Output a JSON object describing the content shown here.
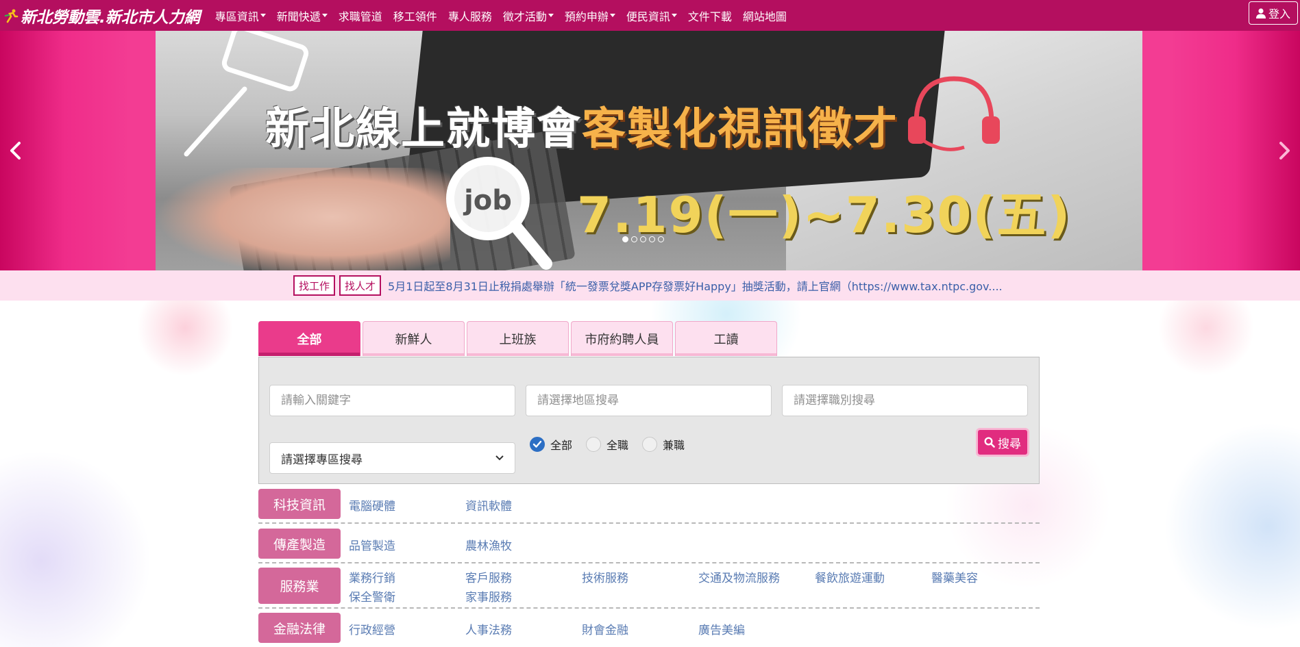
{
  "site": {
    "brand": "新北勞動雲.新北市人力網",
    "login_label": "登入"
  },
  "nav": [
    {
      "label": "專區資訊",
      "dropdown": true
    },
    {
      "label": "新聞快遞",
      "dropdown": true
    },
    {
      "label": "求職管道",
      "dropdown": false
    },
    {
      "label": "移工領件",
      "dropdown": false
    },
    {
      "label": "專人服務",
      "dropdown": false
    },
    {
      "label": "徵才活動",
      "dropdown": true
    },
    {
      "label": "預約申辦",
      "dropdown": true
    },
    {
      "label": "便民資訊",
      "dropdown": true
    },
    {
      "label": "文件下載",
      "dropdown": false
    },
    {
      "label": "網站地圖",
      "dropdown": false
    }
  ],
  "banner": {
    "title_white": "新北線上就博會",
    "title_orange": "客製化視訊徵才",
    "date": "7.19(一)~7.30(五)",
    "job_label": "job",
    "slide_count": 5,
    "active_slide": 0
  },
  "strip": {
    "find_job": "找工作",
    "find_talent": "找人才",
    "news": "5月1日起至8月31日止稅捐處舉辦「統一發票兌獎APP存發票好Happy」抽獎活動，請上官網（https://www.tax.ntpc.gov...."
  },
  "tabs": [
    {
      "label": "全部",
      "active": true
    },
    {
      "label": "新鮮人",
      "active": false
    },
    {
      "label": "上班族",
      "active": false
    },
    {
      "label": "市府約聘人員",
      "active": false
    },
    {
      "label": "工讀",
      "active": false
    }
  ],
  "search": {
    "keyword_placeholder": "請輸入關鍵字",
    "area_placeholder": "請選擇地區搜尋",
    "job_placeholder": "請選擇職別搜尋",
    "zone_select": "請選擇專區搜尋",
    "radios": [
      {
        "label": "全部",
        "checked": true
      },
      {
        "label": "全職",
        "checked": false
      },
      {
        "label": "兼職",
        "checked": false
      }
    ],
    "button_label": "搜尋"
  },
  "categories": [
    {
      "name": "科技資訊",
      "links": [
        "電腦硬體",
        "資訊軟體"
      ]
    },
    {
      "name": "傳產製造",
      "links": [
        "品管製造",
        "農林漁牧"
      ]
    },
    {
      "name": "服務業",
      "links": [
        "業務行銷",
        "客戶服務",
        "技術服務",
        "交通及物流服務",
        "餐飲旅遊運動",
        "醫藥美容",
        "保全警衛",
        "家事服務"
      ]
    },
    {
      "name": "金融法律",
      "links": [
        "行政經營",
        "人事法務",
        "財會金融",
        "廣告美編"
      ]
    }
  ],
  "colors": {
    "navbar": "#b40f5f",
    "banner": "#f33c93",
    "accent": "#ea3b8b",
    "category_badge": "#d4689a",
    "link": "#5a7cb3"
  }
}
